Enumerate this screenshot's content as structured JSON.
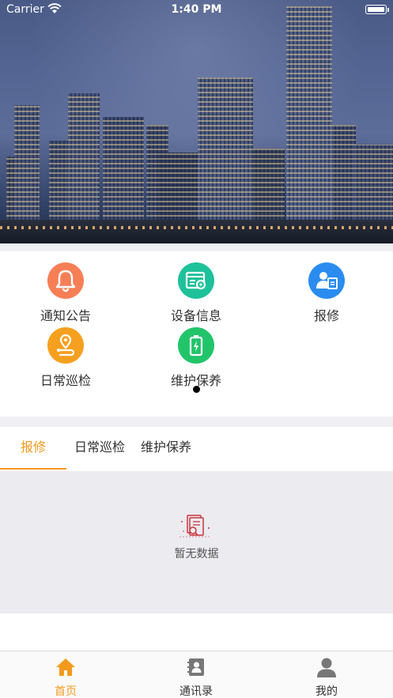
{
  "status_bar": {
    "carrier": "Carrier",
    "time": "1:40 PM",
    "battery_level": 1.0
  },
  "features": [
    {
      "label": "通知公告",
      "color": "#f77f55",
      "icon": "bell-icon"
    },
    {
      "label": "设备信息",
      "color": "#1ec19a",
      "icon": "device-settings-icon"
    },
    {
      "label": "报修",
      "color": "#2b8cef",
      "icon": "repair-report-icon"
    },
    {
      "label": "日常巡检",
      "color": "#f6a020",
      "icon": "route-pin-icon"
    },
    {
      "label": "维护保养",
      "color": "#22c46a",
      "icon": "battery-maintenance-icon"
    }
  ],
  "carousel": {
    "pages": 1,
    "current": 1
  },
  "tabs": [
    {
      "label": "报修",
      "active": true
    },
    {
      "label": "日常巡检",
      "active": false
    },
    {
      "label": "维护保养",
      "active": false
    }
  ],
  "empty_state": {
    "text": "暂无数据",
    "icon": "no-data-document-icon"
  },
  "tabbar": [
    {
      "label": "首页",
      "icon": "home-icon",
      "active": true
    },
    {
      "label": "通讯录",
      "icon": "contacts-icon",
      "active": false
    },
    {
      "label": "我的",
      "icon": "user-icon",
      "active": false
    }
  ],
  "colors": {
    "accent": "#f39a1e",
    "background": "#efeff4"
  }
}
